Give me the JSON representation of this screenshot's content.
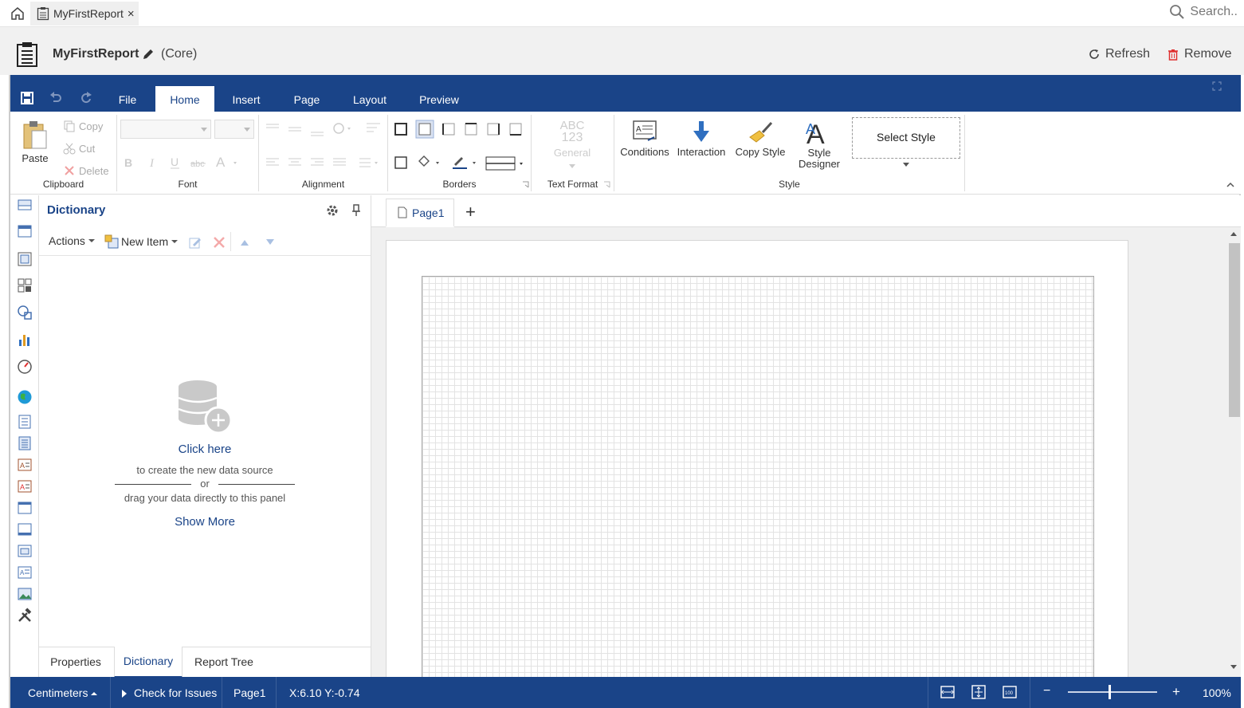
{
  "topbar": {
    "doc_tab_label": "MyFirstReport",
    "doc_tab_close": "×",
    "search_placeholder": "Search.."
  },
  "header": {
    "title": "MyFirstReport",
    "subtitle": "(Core)",
    "refresh_label": "Refresh",
    "remove_label": "Remove"
  },
  "ribbon_tabs": [
    {
      "label": "File"
    },
    {
      "label": "Home"
    },
    {
      "label": "Insert"
    },
    {
      "label": "Page"
    },
    {
      "label": "Layout"
    },
    {
      "label": "Preview"
    }
  ],
  "ribbon": {
    "clipboard": {
      "paste": "Paste",
      "copy": "Copy",
      "cut": "Cut",
      "delete": "Delete",
      "label": "Clipboard"
    },
    "font": {
      "label": "Font"
    },
    "alignment": {
      "label": "Alignment"
    },
    "borders": {
      "label": "Borders"
    },
    "text_format": {
      "abc": "ABC",
      "num": "123",
      "general": "General",
      "label": "Text Format"
    },
    "style": {
      "conditions": "Conditions",
      "interaction": "Interaction",
      "copy_style": "Copy Style",
      "style_designer_1": "Style",
      "style_designer_2": "Designer",
      "select_style": "Select Style",
      "label": "Style"
    }
  },
  "dictionary": {
    "title": "Dictionary",
    "actions": "Actions",
    "new_item": "New Item",
    "click_here": "Click here",
    "desc1": "to create the new data source",
    "or": "or",
    "desc2": "drag your data directly to this panel",
    "show_more": "Show More"
  },
  "panel_tabs": [
    {
      "label": "Properties"
    },
    {
      "label": "Dictionary"
    },
    {
      "label": "Report Tree"
    }
  ],
  "page_tab": {
    "label": "Page1",
    "add": "+"
  },
  "status": {
    "units": "Centimeters",
    "check": "Check for Issues",
    "page": "Page1",
    "coords": "X:6.10 Y:-0.74",
    "zoom_minus": "−",
    "zoom_plus": "+",
    "zoom": "100%",
    "zoom_slider_fraction": 0.47
  },
  "colors": {
    "accent": "#1a4488",
    "ribbon_bg": "#ffffff",
    "header_bg": "#f1f1f1"
  }
}
